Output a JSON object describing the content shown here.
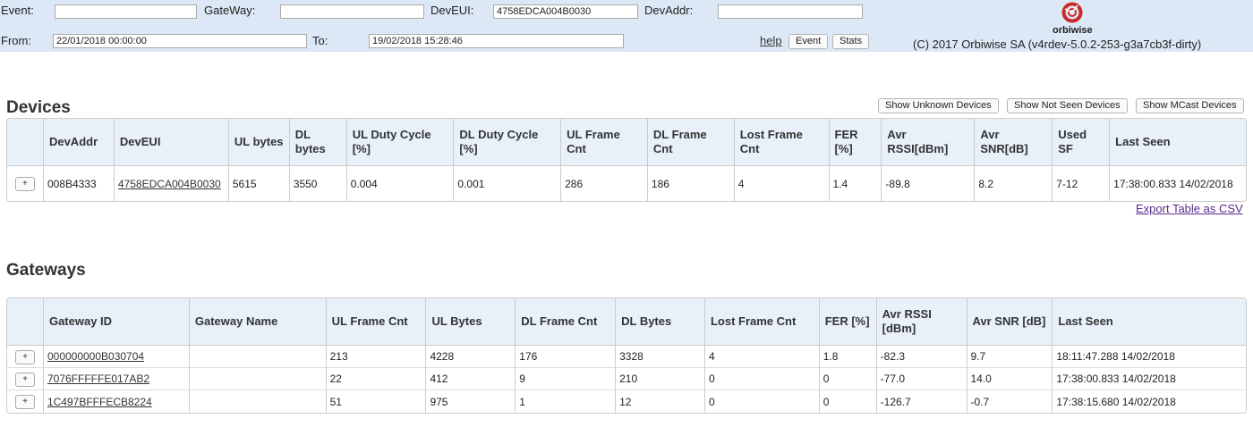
{
  "filters": {
    "event_label": "Event:",
    "event_value": "",
    "gateway_label": "GateWay:",
    "gateway_value": "",
    "deveui_label": "DevEUI:",
    "deveui_value": "4758EDCA004B0030",
    "devaddr_label": "DevAddr:",
    "devaddr_value": "",
    "from_label": "From:",
    "from_value": "22/01/2018 00:00:00",
    "to_label": "To:",
    "to_value": "19/02/2018 15:28:46",
    "help": "help",
    "event_button": "Event",
    "stats_button": "Stats"
  },
  "brand": {
    "logo_text": "orbiwise",
    "copyright": "(C) 2017 Orbiwise SA (v4rdev-5.0.2-253-g3a7cb3f-dirty)",
    "logo_color": "#cc2a2a"
  },
  "devices": {
    "title": "Devices",
    "buttons": [
      "Show Unknown Devices",
      "Show Not Seen Devices",
      "Show MCast Devices"
    ],
    "columns": [
      "DevAddr",
      "DevEUI",
      "UL bytes",
      "DL bytes",
      "UL Duty Cycle [%]",
      "DL Duty Cycle [%]",
      "UL Frame Cnt",
      "DL Frame Cnt",
      "Lost Frame Cnt",
      "FER [%]",
      "Avr RSSI[dBm]",
      "Avr SNR[dB]",
      "Used SF",
      "Last Seen"
    ],
    "rows": [
      [
        "008B4333",
        "4758EDCA004B0030",
        "5615",
        "3550",
        "0.004",
        "0.001",
        "286",
        "186",
        "4",
        "1.4",
        "-89.8",
        "8.2",
        "7-12",
        "17:38:00.833 14/02/2018"
      ]
    ],
    "export": "Export Table as CSV"
  },
  "gateways": {
    "title": "Gateways",
    "columns": [
      "Gateway ID",
      "Gateway Name",
      "UL Frame Cnt",
      "UL Bytes",
      "DL Frame Cnt",
      "DL Bytes",
      "Lost Frame Cnt",
      "FER [%]",
      "Avr RSSI [dBm]",
      "Avr SNR [dB]",
      "Last Seen"
    ],
    "rows": [
      [
        "000000000B030704",
        "",
        "213",
        "4228",
        "176",
        "3328",
        "4",
        "1.8",
        "-82.3",
        "9.7",
        "18:11:47.288 14/02/2018"
      ],
      [
        "7076FFFFFE017AB2",
        "",
        "22",
        "412",
        "9",
        "210",
        "0",
        "0",
        "-77.0",
        "14.0",
        "17:38:00.833 14/02/2018"
      ],
      [
        "1C497BFFFECB8224",
        "",
        "51",
        "975",
        "1",
        "12",
        "0",
        "0",
        "-126.7",
        "-0.7",
        "17:38:15.680 14/02/2018"
      ]
    ]
  },
  "expand_symbol": "+"
}
